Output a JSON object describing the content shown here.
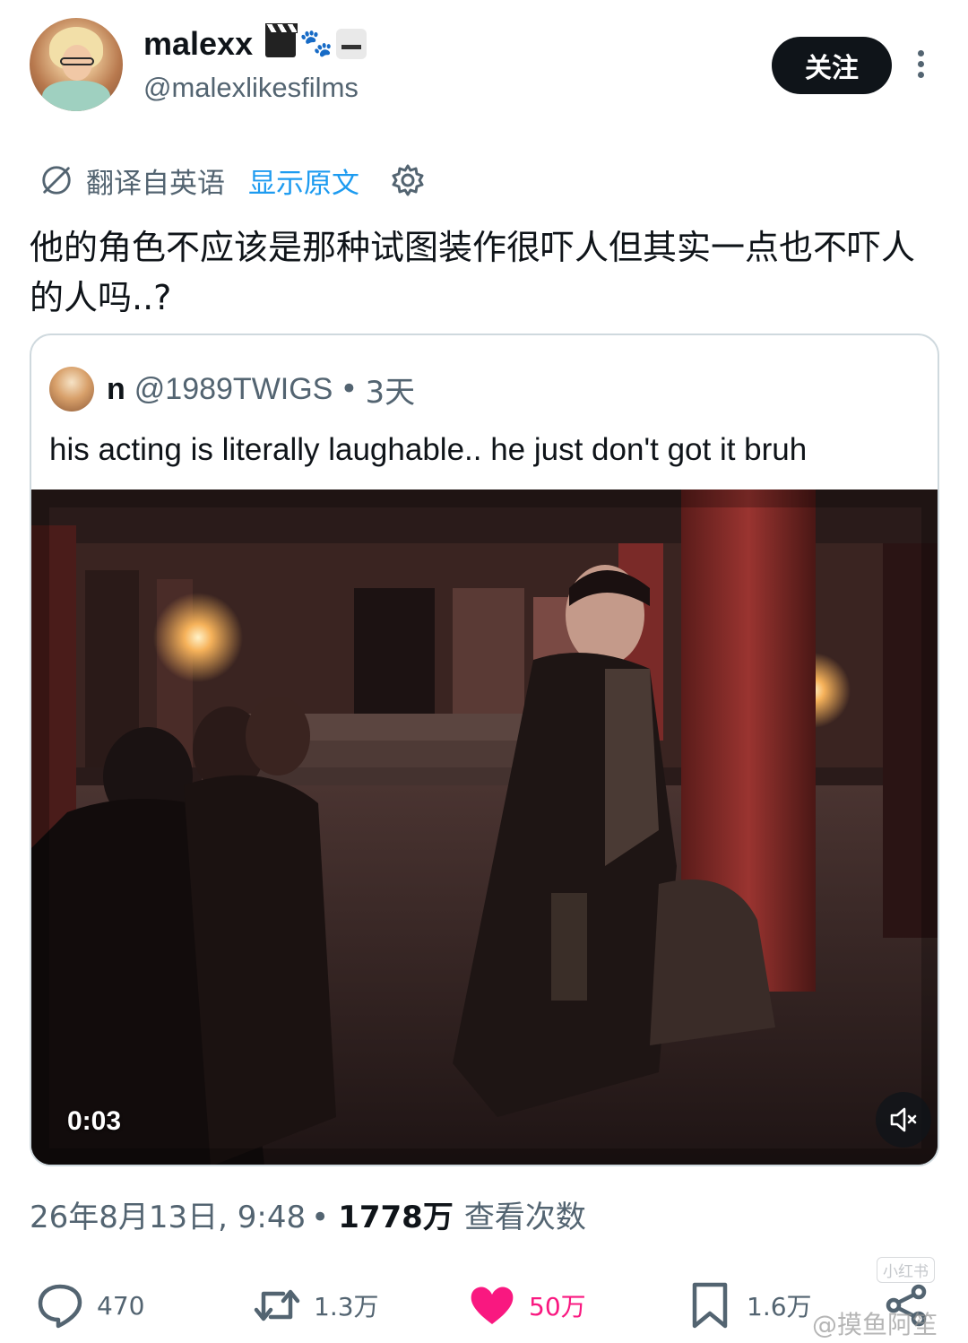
{
  "author": {
    "display_name": "malexx",
    "handle": "@malexlikesfilms",
    "emoji_icons": [
      "clapper-board-icon",
      "paw-prints-icon",
      "martial-arts-uniform-icon"
    ]
  },
  "follow_button": {
    "label": "关注"
  },
  "translation": {
    "label": "翻译自英语",
    "show_original": "显示原文"
  },
  "tweet": {
    "text": "他的角色不应该是那种试图装作很吓人但其实一点也不吓人的人吗..?"
  },
  "quote": {
    "name": "n",
    "handle": "@1989TWIGS",
    "separator": "•",
    "time": "3天",
    "text": "his acting is literally laughable.. he just don't got it bruh",
    "video": {
      "timestamp": "0:03",
      "muted": true
    }
  },
  "meta": {
    "date_time": "26年8月13日, 9:48",
    "separator": "•",
    "views_count": "1778万",
    "views_label": "查看次数"
  },
  "actions": {
    "reply_count": "470",
    "retweet_count": "1.3万",
    "like_count": "50万",
    "bookmark_count": "1.6万",
    "liked": true
  },
  "watermarks": {
    "small": "小红书",
    "main": "@摸鱼阿笙"
  },
  "colors": {
    "accent": "#1d9bf0",
    "like": "#f91880",
    "text_primary": "#0f1419",
    "text_secondary": "#536471",
    "border": "#cfd9de"
  }
}
